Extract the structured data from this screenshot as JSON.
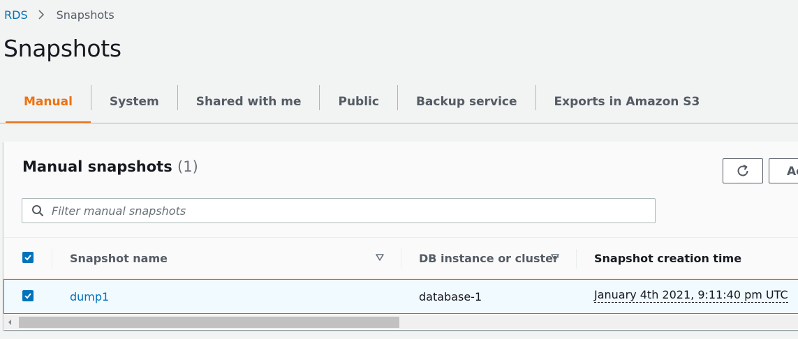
{
  "breadcrumb": {
    "root": "RDS",
    "current": "Snapshots"
  },
  "page": {
    "title": "Snapshots"
  },
  "tabs": [
    {
      "label": "Manual",
      "active": true
    },
    {
      "label": "System",
      "active": false
    },
    {
      "label": "Shared with me",
      "active": false
    },
    {
      "label": "Public",
      "active": false
    },
    {
      "label": "Backup service",
      "active": false
    },
    {
      "label": "Exports in Amazon S3",
      "active": false
    }
  ],
  "panel": {
    "title": "Manual snapshots",
    "count": "(1)",
    "actions_label": "Actions",
    "search_placeholder": "Filter manual snapshots"
  },
  "table": {
    "columns": [
      "Snapshot name",
      "DB instance or cluster",
      "Snapshot creation time"
    ],
    "rows": [
      {
        "name": "dump1",
        "instance": "database-1",
        "created": "January 4th 2021, 9:11:40 pm UTC",
        "selected": true
      }
    ]
  },
  "icons": [
    "chevron-right-icon",
    "refresh-icon",
    "search-icon",
    "sort-caret-icon",
    "checkmark-icon",
    "scroll-left-icon"
  ],
  "colors": {
    "accent": "#ec7211",
    "link": "#0073bb",
    "selected_row_bg": "#f1faff",
    "selected_row_border": "#00a1c9"
  }
}
